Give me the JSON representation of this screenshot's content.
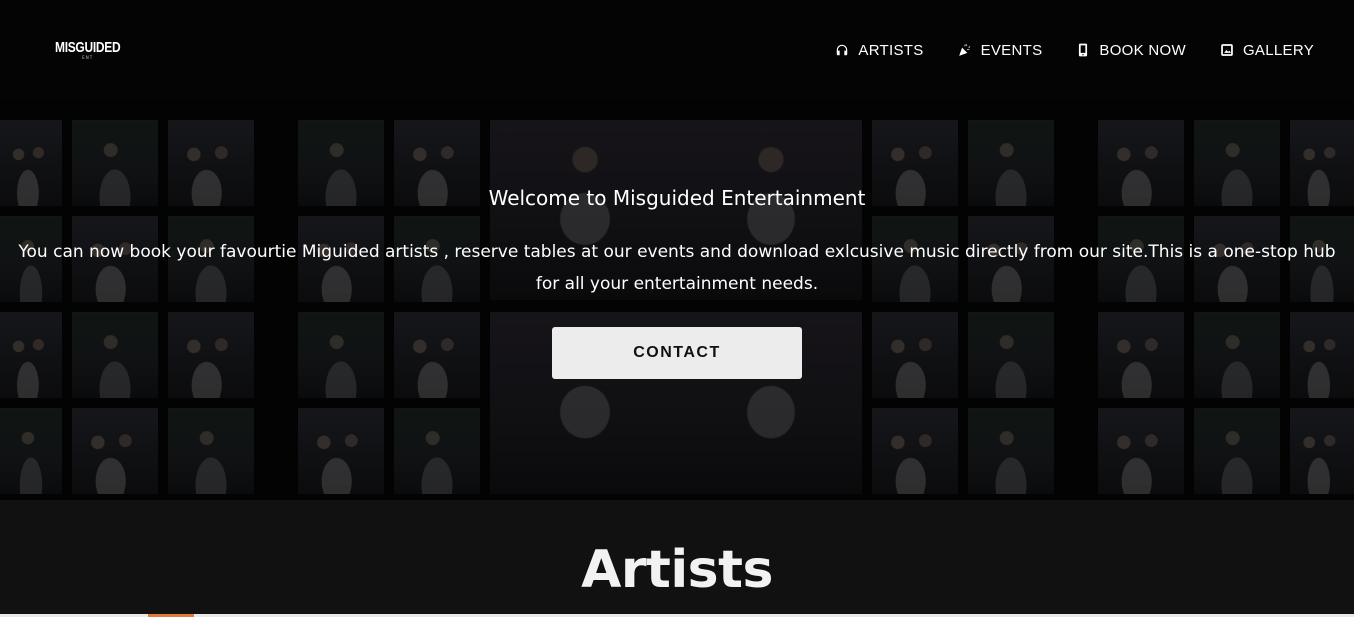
{
  "logo": {
    "text": "MISGUIDED",
    "sub": "ENT"
  },
  "nav": {
    "items": [
      {
        "label": "ARTISTS",
        "icon": "headphones-icon"
      },
      {
        "label": "EVENTS",
        "icon": "party-popper-icon"
      },
      {
        "label": "BOOK NOW",
        "icon": "phone-icon"
      },
      {
        "label": "GALLERY",
        "icon": "image-icon"
      }
    ]
  },
  "hero": {
    "title": "Welcome to Misguided Entertainment",
    "text": "You can now book your favourtie Miguided artists , reserve tables at our events and download exlcusive music directly from our site.This is a one-stop hub for all your entertainment needs.",
    "button": "CONTACT"
  },
  "artists": {
    "heading": "Artists"
  },
  "colors": {
    "navbar": "#040404",
    "page_background": "#111111",
    "button_background": "#ececec",
    "accent": "#e07a3a"
  }
}
